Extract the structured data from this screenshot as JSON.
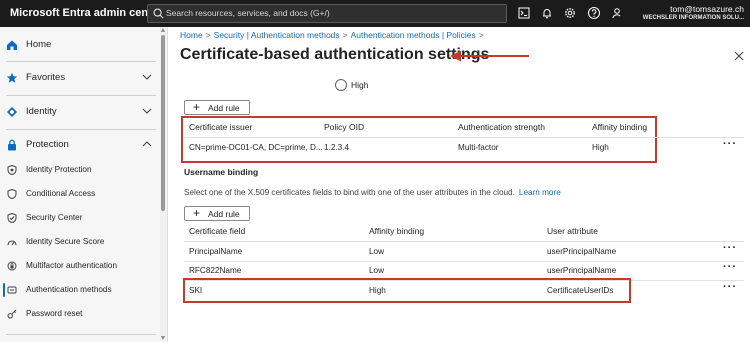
{
  "topbar": {
    "brand": "Microsoft Entra admin center",
    "search_placeholder": "Search resources, services, and docs (G+/)",
    "icons": [
      "cloud-shell-icon",
      "bell-icon",
      "gear-icon",
      "help-icon",
      "feedback-icon"
    ],
    "user_email": "tom@tomsazure.ch",
    "user_org": "WECHSLER INFORMATION SOLU..."
  },
  "sidebar": {
    "items": [
      {
        "label": "Home",
        "icon": "home-icon"
      },
      {
        "label": "Favorites",
        "icon": "star-icon"
      },
      {
        "label": "Identity",
        "icon": "identity-icon"
      },
      {
        "label": "Protection",
        "icon": "lock-icon"
      }
    ],
    "sub_items": [
      {
        "label": "Identity Protection",
        "icon": "shield-icon"
      },
      {
        "label": "Conditional Access",
        "icon": "conditional-access-icon"
      },
      {
        "label": "Security Center",
        "icon": "security-center-icon"
      },
      {
        "label": "Identity Secure Score",
        "icon": "score-icon"
      },
      {
        "label": "Multifactor authentication",
        "icon": "mfa-icon"
      },
      {
        "label": "Authentication methods",
        "icon": "auth-methods-icon",
        "active": true
      },
      {
        "label": "Password reset",
        "icon": "key-icon"
      }
    ]
  },
  "breadcrumb": [
    "Home",
    "Security | Authentication methods",
    "Authentication methods | Policies"
  ],
  "page": {
    "title": "Certificate-based authentication settings",
    "radio_label": "High",
    "add_rule_label": "Add rule"
  },
  "rules_table": {
    "headers": [
      "Certificate issuer",
      "Policy OID",
      "Authentication strength",
      "Affinity binding"
    ],
    "rows": [
      [
        "CN=prime-DC01-CA, DC=prime, D...",
        "1.2.3.4",
        "Multi-factor",
        "High"
      ]
    ]
  },
  "username_binding": {
    "heading": "Username binding",
    "description": "Select one of the X.509 certificates fields to bind with one of the user attributes in the cloud.",
    "learn_more": "Learn more",
    "add_rule_label": "Add rule",
    "headers": [
      "Certificate field",
      "Affinity binding",
      "User attribute"
    ],
    "rows": [
      [
        "PrincipalName",
        "Low",
        "userPrincipalName"
      ],
      [
        "RFC822Name",
        "Low",
        "userPrincipalName"
      ],
      [
        "SKI",
        "High",
        "CertificateUserIDs"
      ]
    ]
  },
  "more_label": "···",
  "colors": {
    "accent": "#0f6cbd",
    "highlight": "#c23b2b",
    "topbar": "#1b1b1b"
  }
}
